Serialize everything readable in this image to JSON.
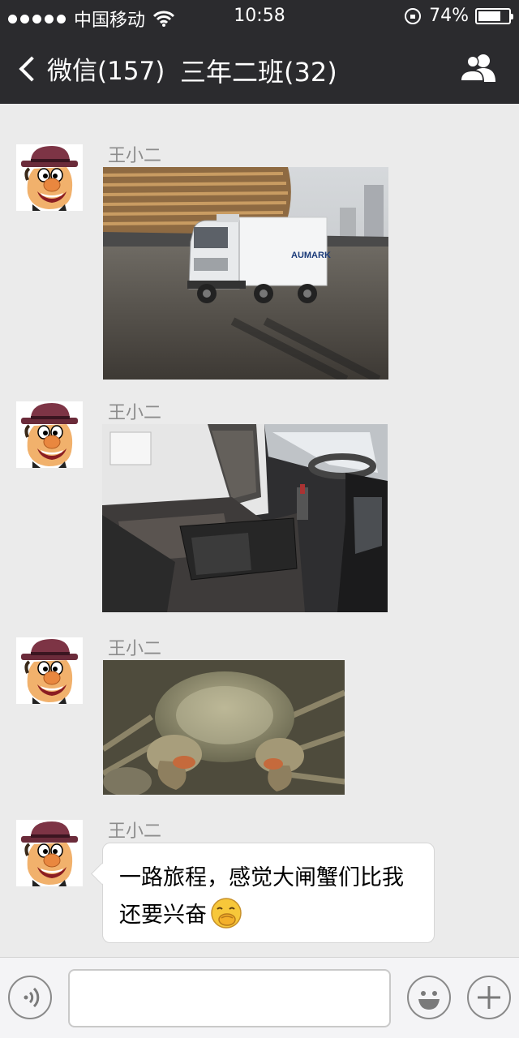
{
  "status_bar": {
    "carrier": "中国移动",
    "time": "10:58",
    "battery_text": "74%",
    "battery_level": 0.74,
    "icons": [
      "signal-dots-icon",
      "wifi-icon",
      "orientation-lock-icon",
      "battery-icon"
    ]
  },
  "nav": {
    "back_label": "微信(157)",
    "title": "三年二班(32)",
    "right_icon": "group-members-icon"
  },
  "messages": [
    {
      "sender": "王小二",
      "type": "image",
      "image": "refrigerated-truck-photo",
      "image_text": "AUMARK"
    },
    {
      "sender": "王小二",
      "type": "image",
      "image": "truck-cabin-interior-photo"
    },
    {
      "sender": "王小二",
      "type": "image",
      "image": "hairy-crab-photo"
    },
    {
      "sender": "王小二",
      "type": "text",
      "line1": "一路旅程，感觉大闸蟹们比我",
      "line2": "还要兴奋",
      "emoji": "giggle-emoji-icon"
    }
  ],
  "input_bar": {
    "icons": [
      "voice-icon",
      "emoji-icon",
      "plus-icon"
    ],
    "value": ""
  },
  "colors": {
    "bar_dark": "#2b2b2e",
    "chat_bg": "#ebebeb",
    "sender_gray": "#8c8c8c",
    "bubble_bg": "#ffffff"
  }
}
